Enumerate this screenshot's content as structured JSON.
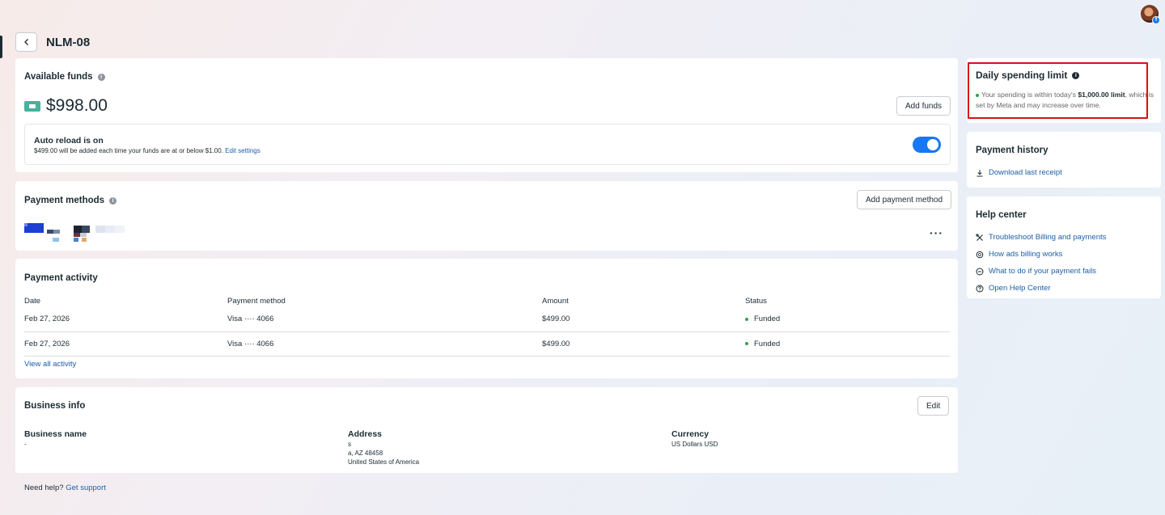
{
  "page": {
    "title": "NLM-08",
    "need_help_label": "Need help?",
    "get_support_label": "Get support"
  },
  "funds": {
    "title": "Available funds",
    "balance": "$998.00",
    "add_funds_label": "Add funds",
    "auto_reload_title": "Auto reload is on",
    "auto_reload_desc": "$499.00 will be added each time your funds are at or below $1.00.",
    "edit_settings_label": "Edit settings",
    "auto_reload_enabled": true
  },
  "payment_methods": {
    "title": "Payment methods",
    "add_label": "Add payment method",
    "more_label": "···"
  },
  "activity": {
    "title": "Payment activity",
    "columns": [
      "Date",
      "Payment method",
      "Amount",
      "Status"
    ],
    "rows": [
      {
        "date": "Feb 27, 2026",
        "method": "Visa ···· 4066",
        "amount": "$499.00",
        "status": "Funded"
      },
      {
        "date": "Feb 27, 2026",
        "method": "Visa ···· 4066",
        "amount": "$499.00",
        "status": "Funded"
      }
    ],
    "view_all_label": "View all activity"
  },
  "business": {
    "title": "Business info",
    "edit_label": "Edit",
    "business_name_label": "Business name",
    "business_name_value": "-",
    "address_label": "Address",
    "address_line1": "s",
    "address_line2": "a, AZ 48458",
    "address_line3": "United States of America",
    "currency_label": "Currency",
    "currency_value": "US Dollars USD"
  },
  "daily_limit": {
    "title": "Daily spending limit",
    "text_pre": "Your spending is within today's ",
    "limit": "$1,000.00 limit",
    "text_post": ", which is set by Meta and may increase over time."
  },
  "payment_history": {
    "title": "Payment history",
    "download_label": "Download last receipt"
  },
  "help_center": {
    "title": "Help center",
    "links": [
      {
        "label": "Troubleshoot Billing and payments",
        "icon": "tools-icon"
      },
      {
        "label": "How ads billing works",
        "icon": "coins-icon"
      },
      {
        "label": "What to do if your payment fails",
        "icon": "minus-circle-icon"
      },
      {
        "label": "Open Help Center",
        "icon": "question-circle-icon"
      }
    ]
  },
  "colors": {
    "accent": "#1877f2",
    "link": "#216fdb",
    "status_green": "#31a24c",
    "highlight_red": "#d8101a",
    "wallet_green": "#45b39d"
  }
}
